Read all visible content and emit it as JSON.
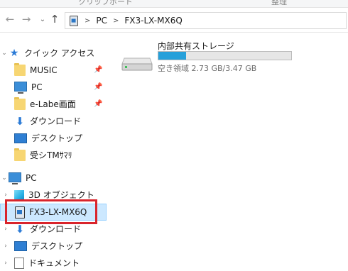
{
  "ribbon": {
    "left_label": "クリップボード",
    "right_label": "整理"
  },
  "address": {
    "crumbs": [
      "PC",
      "FX3-LX-MX6Q"
    ]
  },
  "nav": {
    "quick_access": "クイック アクセス",
    "quick_items": [
      {
        "label": "MUSIC",
        "icon": "folder-icon",
        "pinned": true
      },
      {
        "label": "PC",
        "icon": "monitor-icon",
        "pinned": true
      },
      {
        "label": "e-Labe画面",
        "icon": "folder-icon",
        "pinned": true
      },
      {
        "label": "ダウンロード",
        "icon": "download-arrow-icon",
        "pinned": false
      },
      {
        "label": "デスクトップ",
        "icon": "desktop-icon",
        "pinned": false
      },
      {
        "label": "受シTMｻﾏﾘ",
        "icon": "folder-icon",
        "pinned": false
      }
    ],
    "pc": "PC",
    "pc_items": [
      {
        "label": "3D オブジェクト",
        "icon": "cube-icon"
      },
      {
        "label": "FX3-LX-MX6Q",
        "icon": "device-icon",
        "selected": true
      },
      {
        "label": "ダウンロード",
        "icon": "download-arrow-icon"
      },
      {
        "label": "デスクトップ",
        "icon": "desktop-icon"
      },
      {
        "label": "ドキュメント",
        "icon": "document-icon"
      }
    ]
  },
  "drive": {
    "name": "内部共有ストレージ",
    "free_text": "空き領域 2.73 GB/3.47 GB",
    "used_fraction": 0.21
  },
  "colors": {
    "accent": "#26a0da",
    "selection": "#cce8ff",
    "highlight": "#d9242c"
  }
}
